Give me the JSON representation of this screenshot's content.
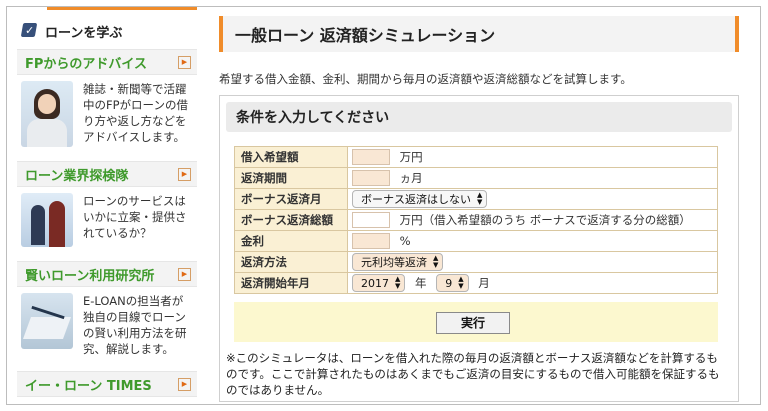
{
  "sidebar": {
    "header": "ローンを学ぶ",
    "sections": [
      {
        "title": "FPからのアドバイス",
        "text": "雑誌・新聞等で活躍中のFPがローンの借り方や返し方などをアドバイスします。",
        "image": "woman-photo"
      },
      {
        "title": "ローン業界探検隊",
        "text": "ローンのサービスはいかに立案・提供されているか？",
        "image": "people-photo"
      },
      {
        "title": "賢いローン利用研究所",
        "text": "E-LOANの担当者が独自の目線でローンの賢い利用方法を研究、解説します。",
        "image": "desk-photo"
      },
      {
        "title": "イー・ローン TIMES",
        "text": "",
        "image": ""
      }
    ]
  },
  "main": {
    "title": "一般ローン 返済額シミュレーション",
    "intro": "希望する借入金額、金利、期間から毎月の返済額や返済総額などを試算します。",
    "panel_title": "条件を入力してください",
    "rows": {
      "amount": {
        "label": "借入希望額",
        "value": "",
        "unit": "万円"
      },
      "period": {
        "label": "返済期間",
        "value": "",
        "unit": "ヵ月"
      },
      "bonus_month": {
        "label": "ボーナス返済月",
        "selected": "ボーナス返済はしない"
      },
      "bonus_total": {
        "label": "ボーナス返済総額",
        "value": "",
        "unit": "万円（借入希望額のうち ボーナスで返済する分の総額）"
      },
      "rate": {
        "label": "金利",
        "value": "",
        "unit": "%"
      },
      "method": {
        "label": "返済方法",
        "selected": "元利均等返済"
      },
      "start": {
        "label": "返済開始年月",
        "year": "2017",
        "year_unit": "年",
        "month": "9",
        "month_unit": "月"
      }
    },
    "submit_label": "実行",
    "note": "※このシミュレータは、ローンを借入れた際の毎月の返済額とボーナス返済額などを計算するものです。ここで計算されたものはあくまでもご返済の目安にするもので借入可能額を保証するものではありません。"
  },
  "colors": {
    "accent": "#f08c2a",
    "section_title": "#3f9a2c",
    "label_bg": "#faf0d4",
    "input_bg": "#f9e7d4",
    "submit_area": "#fcf8cf"
  },
  "icons": {
    "header": "book-check-icon",
    "section_arrow": "arrow-right-icon",
    "select": "chevron-updown-icon"
  }
}
